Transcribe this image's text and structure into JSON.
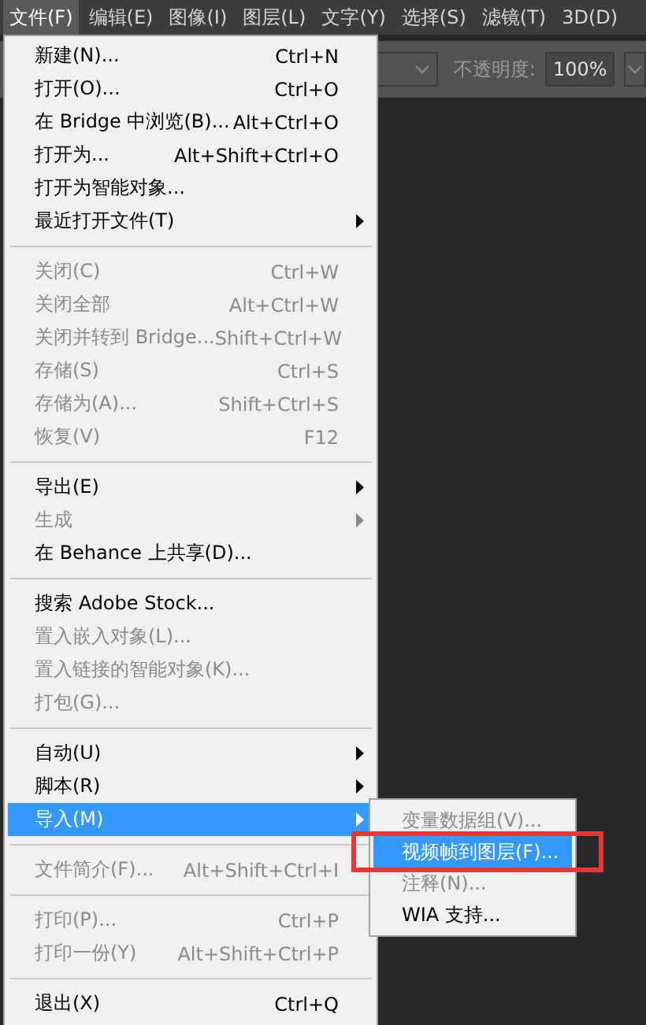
{
  "menubar": [
    {
      "label": "文件(F)",
      "selected": true
    },
    {
      "label": "编辑(E)",
      "selected": false
    },
    {
      "label": "图像(I)",
      "selected": false
    },
    {
      "label": "图层(L)",
      "selected": false
    },
    {
      "label": "文字(Y)",
      "selected": false
    },
    {
      "label": "选择(S)",
      "selected": false
    },
    {
      "label": "滤镜(T)",
      "selected": false
    },
    {
      "label": "3D(D)",
      "selected": false
    }
  ],
  "options_bar": {
    "opacity_label": "不透明度:",
    "opacity_value": "100%"
  },
  "file_menu": [
    {
      "kind": "item",
      "label": "新建(N)...",
      "shortcut": "Ctrl+N",
      "disabled": false,
      "submenu": false,
      "selected": false
    },
    {
      "kind": "item",
      "label": "打开(O)...",
      "shortcut": "Ctrl+O",
      "disabled": false,
      "submenu": false,
      "selected": false
    },
    {
      "kind": "item",
      "label": "在 Bridge 中浏览(B)...",
      "shortcut": "Alt+Ctrl+O",
      "disabled": false,
      "submenu": false,
      "selected": false
    },
    {
      "kind": "item",
      "label": "打开为...",
      "shortcut": "Alt+Shift+Ctrl+O",
      "disabled": false,
      "submenu": false,
      "selected": false
    },
    {
      "kind": "item",
      "label": "打开为智能对象...",
      "disabled": false,
      "submenu": false,
      "selected": false
    },
    {
      "kind": "item",
      "label": "最近打开文件(T)",
      "disabled": false,
      "submenu": true,
      "selected": false
    },
    {
      "kind": "separator"
    },
    {
      "kind": "item",
      "label": "关闭(C)",
      "shortcut": "Ctrl+W",
      "disabled": true,
      "submenu": false,
      "selected": false
    },
    {
      "kind": "item",
      "label": "关闭全部",
      "shortcut": "Alt+Ctrl+W",
      "disabled": true,
      "submenu": false,
      "selected": false
    },
    {
      "kind": "item",
      "label": "关闭并转到 Bridge...",
      "shortcut": "Shift+Ctrl+W",
      "disabled": true,
      "submenu": false,
      "selected": false
    },
    {
      "kind": "item",
      "label": "存储(S)",
      "shortcut": "Ctrl+S",
      "disabled": true,
      "submenu": false,
      "selected": false
    },
    {
      "kind": "item",
      "label": "存储为(A)...",
      "shortcut": "Shift+Ctrl+S",
      "disabled": true,
      "submenu": false,
      "selected": false
    },
    {
      "kind": "item",
      "label": "恢复(V)",
      "shortcut": "F12",
      "disabled": true,
      "submenu": false,
      "selected": false
    },
    {
      "kind": "separator"
    },
    {
      "kind": "item",
      "label": "导出(E)",
      "disabled": false,
      "submenu": true,
      "selected": false
    },
    {
      "kind": "item",
      "label": "生成",
      "disabled": true,
      "submenu": true,
      "selected": false
    },
    {
      "kind": "item",
      "label": "在 Behance 上共享(D)...",
      "disabled": false,
      "submenu": false,
      "selected": false
    },
    {
      "kind": "separator"
    },
    {
      "kind": "item",
      "label": "搜索 Adobe Stock...",
      "disabled": false,
      "submenu": false,
      "selected": false
    },
    {
      "kind": "item",
      "label": "置入嵌入对象(L)...",
      "disabled": true,
      "submenu": false,
      "selected": false
    },
    {
      "kind": "item",
      "label": "置入链接的智能对象(K)...",
      "disabled": true,
      "submenu": false,
      "selected": false
    },
    {
      "kind": "item",
      "label": "打包(G)...",
      "disabled": true,
      "submenu": false,
      "selected": false
    },
    {
      "kind": "separator"
    },
    {
      "kind": "item",
      "label": "自动(U)",
      "disabled": false,
      "submenu": true,
      "selected": false
    },
    {
      "kind": "item",
      "label": "脚本(R)",
      "disabled": false,
      "submenu": true,
      "selected": false
    },
    {
      "kind": "item",
      "label": "导入(M)",
      "disabled": false,
      "submenu": true,
      "selected": true
    },
    {
      "kind": "separator"
    },
    {
      "kind": "item",
      "label": "文件简介(F)...",
      "shortcut": "Alt+Shift+Ctrl+I",
      "disabled": true,
      "submenu": false,
      "selected": false
    },
    {
      "kind": "separator"
    },
    {
      "kind": "item",
      "label": "打印(P)...",
      "shortcut": "Ctrl+P",
      "disabled": true,
      "submenu": false,
      "selected": false
    },
    {
      "kind": "item",
      "label": "打印一份(Y)",
      "shortcut": "Alt+Shift+Ctrl+P",
      "disabled": true,
      "submenu": false,
      "selected": false
    },
    {
      "kind": "separator"
    },
    {
      "kind": "item",
      "label": "退出(X)",
      "shortcut": "Ctrl+Q",
      "disabled": false,
      "submenu": false,
      "selected": false
    }
  ],
  "import_submenu": [
    {
      "label": "变量数据组(V)...",
      "disabled": true,
      "selected": false
    },
    {
      "label": "视频帧到图层(F)...",
      "disabled": false,
      "selected": true
    },
    {
      "label": "注释(N)...",
      "disabled": true,
      "selected": false
    },
    {
      "label": "WIA 支持...",
      "disabled": false,
      "selected": false
    }
  ]
}
